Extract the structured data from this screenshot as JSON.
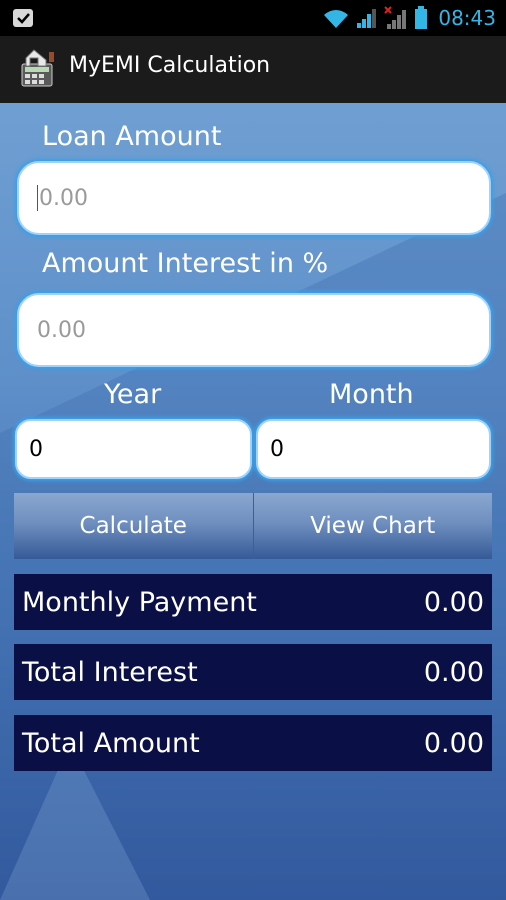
{
  "status_bar": {
    "time": "08:43",
    "icons": [
      "notification-check-icon",
      "wifi-icon",
      "signal-icon",
      "signal-no-service-icon",
      "battery-icon"
    ]
  },
  "action_bar": {
    "title": "MyEMI Calculation",
    "logo_icon": "calculator-house-icon"
  },
  "form": {
    "loan_amount": {
      "label": "Loan Amount",
      "placeholder": "0.00"
    },
    "interest": {
      "label": "Amount Interest in %",
      "placeholder": "0.00"
    },
    "year": {
      "label": "Year",
      "value": "0"
    },
    "month": {
      "label": "Month",
      "value": "0"
    }
  },
  "buttons": {
    "calculate": "Calculate",
    "view_chart": "View Chart"
  },
  "results": [
    {
      "label": "Monthly Payment",
      "value": "0.00"
    },
    {
      "label": "Total Interest",
      "value": "0.00"
    },
    {
      "label": "Total Amount",
      "value": "0.00"
    }
  ],
  "colors": {
    "accent": "#33b5e5",
    "background_top": "#6f9fd2",
    "background_bottom": "#2c4f94",
    "result_bg": "#0a0f45",
    "input_glow": "#3aa0e6"
  }
}
